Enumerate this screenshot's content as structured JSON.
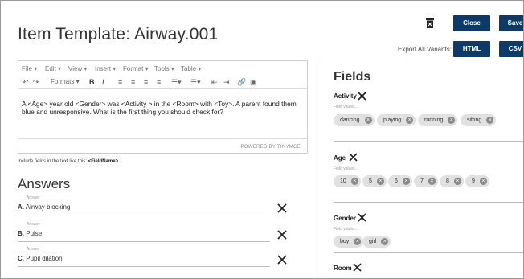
{
  "header": {
    "title": "Item Template: Airway.001",
    "close_label": "Close",
    "save_label": "Save",
    "export_label": "Export All Variants:",
    "html_label": "HTML",
    "csv_label": "CSV"
  },
  "editor": {
    "menu": [
      "File",
      "Edit",
      "View",
      "Insert",
      "Format",
      "Tools",
      "Table"
    ],
    "formats_label": "Formats",
    "content": "A <Age> year old <Gender> was <Activity > in the <Room> with <Toy>.  A parent found them blue and unresponsive.  What is the first thing you should check for?",
    "powered_by": "POWERED BY TINYMCE"
  },
  "hint": {
    "text": "Include fields in the text like this:",
    "example": "<FieldName>"
  },
  "answers": {
    "title": "Answers",
    "field_label": "Answer",
    "items": [
      {
        "letter": "A.",
        "text": "Airway blocking"
      },
      {
        "letter": "B.",
        "text": "Pulse"
      },
      {
        "letter": "C.",
        "text": "Pupil dilation"
      }
    ]
  },
  "fields": {
    "title": "Fields",
    "values_label": "Field values...",
    "groups": [
      {
        "name": "Activity",
        "values": [
          "dancing",
          "playing",
          "running",
          "sitting"
        ]
      },
      {
        "name": "Age",
        "values": [
          "10",
          "5",
          "6",
          "7",
          "8",
          "9"
        ]
      },
      {
        "name": "Gender",
        "values": [
          "boy",
          "girl"
        ]
      },
      {
        "name": "Room",
        "values": []
      }
    ]
  },
  "colors": {
    "button_bg": "#0d3a66",
    "chip_bg": "#e1e1e1"
  }
}
